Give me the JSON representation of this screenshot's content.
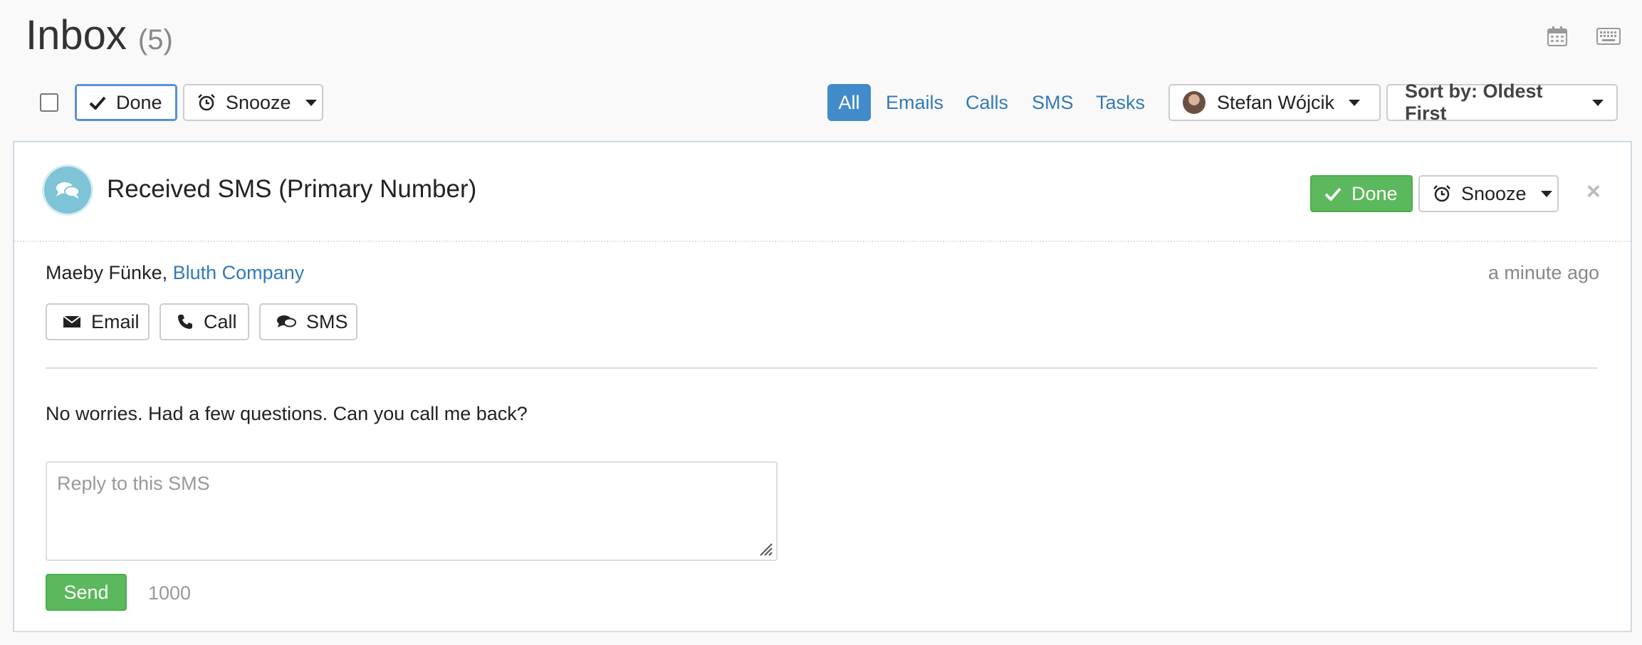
{
  "header": {
    "title": "Inbox",
    "count": "(5)"
  },
  "top_icons": [
    "calendar-icon",
    "keyboard-icon"
  ],
  "toolbar": {
    "done_label": "Done",
    "snooze_label": "Snooze",
    "filters": [
      "All",
      "Emails",
      "Calls",
      "SMS",
      "Tasks"
    ],
    "active_filter": "All",
    "user_name": "Stefan Wójcik",
    "sort_label": "Sort by: Oldest First"
  },
  "card": {
    "title": "Received SMS (Primary Number)",
    "done_label": "Done",
    "snooze_label": "Snooze",
    "close_glyph": "×",
    "contact_name": "Maeby Fünke,",
    "company": "Bluth Company",
    "timestamp": "a minute ago",
    "actions": {
      "email": "Email",
      "call": "Call",
      "sms": "SMS"
    },
    "message": "No worries. Had a few questions. Can you call me back?",
    "reply_placeholder": "Reply to this SMS",
    "send_label": "Send",
    "char_count": "1000"
  },
  "colors": {
    "primary": "#428bca",
    "link": "#337ab7",
    "success": "#5cb85c",
    "sms_icon_bg": "#7ec3d6"
  }
}
